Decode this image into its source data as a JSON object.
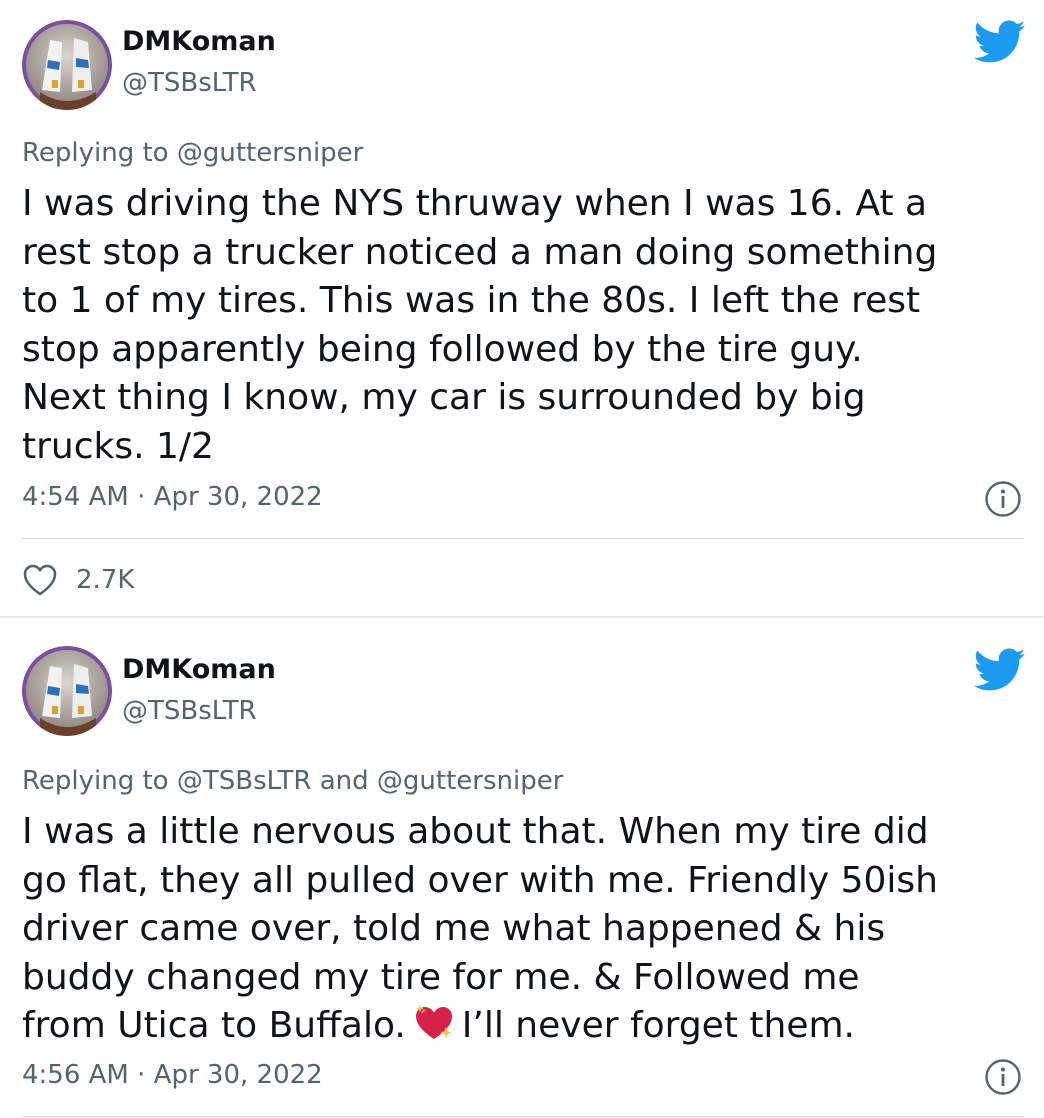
{
  "tweets": [
    {
      "display_name": "DMKoman",
      "handle": "@TSBsLTR",
      "replying_prefix": "Replying to",
      "replying_to": "@guttersniper",
      "body_lines": [
        "I was driving the NYS thruway when I was 16. At a",
        "rest stop a trucker noticed a man doing something",
        "to 1 of my tires. This was in the 80s. I left the rest",
        "stop apparently being followed by the tire guy.",
        "Next thing I know, my car is surrounded by big",
        "trucks. 1/2"
      ],
      "timestamp": "4:54 AM · Apr 30, 2022",
      "like_count": "2.7K"
    },
    {
      "display_name": "DMKoman",
      "handle": "@TSBsLTR",
      "replying_prefix": "Replying to",
      "replying_to": "@TSBsLTR and @guttersniper",
      "body_lines": [
        "I was a little nervous about that. When my tire did",
        "go flat, they all pulled over with me. Friendly 50ish",
        "driver came over, told me what happened & his",
        "buddy changed my tire for me. & Followed me",
        "from Utica to Buffalo."
      ],
      "body_after_emoji": "I’ll never forget them.",
      "timestamp": "4:56 AM · Apr 30, 2022"
    }
  ],
  "colors": {
    "twitter_blue": "#1d9bf0",
    "secondary_text": "#536471",
    "primary_text": "#0f1419",
    "divider": "#cfd9de"
  },
  "icons": {
    "brand": "twitter-bird-icon",
    "info": "info-circle-icon",
    "like": "heart-outline-icon",
    "emoji": "sparkling-heart-emoji"
  }
}
